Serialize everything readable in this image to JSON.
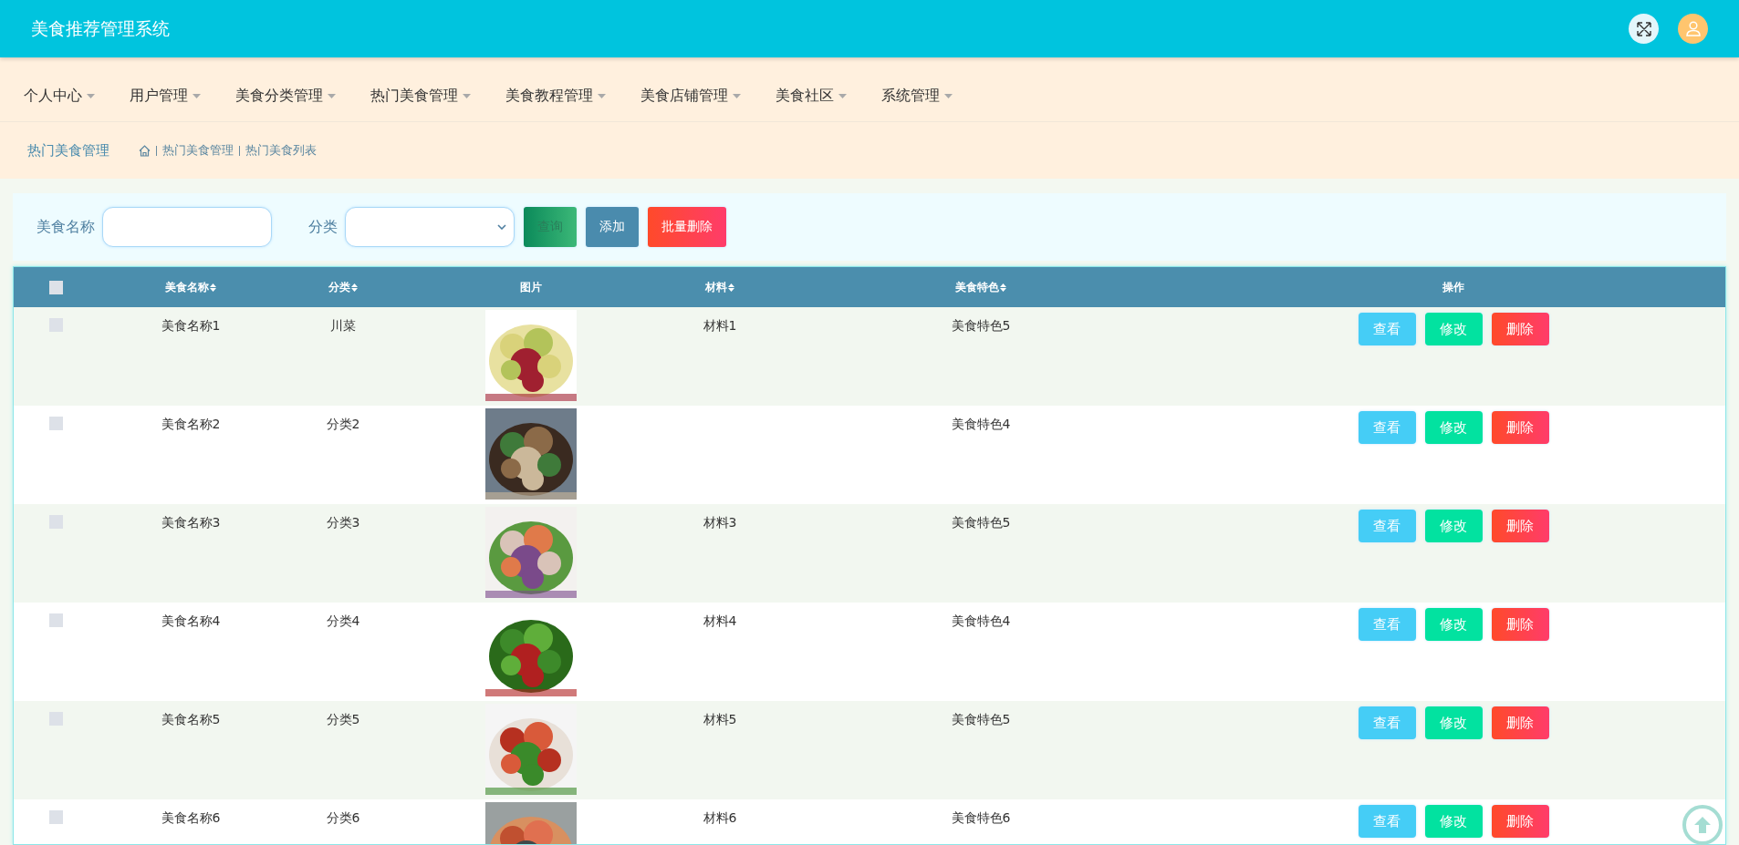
{
  "header": {
    "title": "美食推荐管理系统"
  },
  "nav": [
    {
      "label": "个人中心"
    },
    {
      "label": "用户管理"
    },
    {
      "label": "美食分类管理"
    },
    {
      "label": "热门美食管理"
    },
    {
      "label": "美食教程管理"
    },
    {
      "label": "美食店铺管理"
    },
    {
      "label": "美食社区"
    },
    {
      "label": "系统管理"
    }
  ],
  "breadcrumb": {
    "title": "热门美食管理",
    "items": [
      "热门美食管理",
      "热门美食列表"
    ]
  },
  "search": {
    "fields": [
      {
        "kind": "input",
        "label": "美食名称"
      },
      {
        "kind": "select",
        "label": "分类"
      }
    ],
    "buttons": [
      {
        "kind": "query",
        "label": "查询"
      },
      {
        "kind": "add",
        "label": "添加"
      },
      {
        "kind": "danger",
        "label": "批量删除"
      }
    ]
  },
  "table": {
    "all_checked": false,
    "columns": [
      {
        "label": "美食名称",
        "sortable": true
      },
      {
        "label": "分类",
        "sortable": true
      },
      {
        "label": "图片",
        "sortable": false
      },
      {
        "label": "材料",
        "sortable": true
      },
      {
        "label": "美食特色",
        "sortable": true
      },
      {
        "label": "操作",
        "sortable": false
      }
    ],
    "rows": [
      {
        "checked": false,
        "name": "美食名称1",
        "category": "川菜",
        "material": "材料1",
        "feature": "美食特色5",
        "actions": [
          {
            "kind": "view",
            "label": "查看"
          },
          {
            "kind": "edit",
            "label": "修改"
          },
          {
            "kind": "delete",
            "label": "删除"
          }
        ]
      },
      {
        "checked": false,
        "name": "美食名称2",
        "category": "分类2",
        "feature": "美食特色4",
        "actions": [
          {
            "kind": "view",
            "label": "查看"
          },
          {
            "kind": "edit",
            "label": "修改"
          },
          {
            "kind": "delete",
            "label": "删除"
          }
        ]
      },
      {
        "checked": false,
        "name": "美食名称3",
        "category": "分类3",
        "material": "材料3",
        "feature": "美食特色5",
        "actions": [
          {
            "kind": "view",
            "label": "查看"
          },
          {
            "kind": "edit",
            "label": "修改"
          },
          {
            "kind": "delete",
            "label": "删除"
          }
        ]
      },
      {
        "checked": false,
        "name": "美食名称4",
        "category": "分类4",
        "material": "材料4",
        "feature": "美食特色4",
        "actions": [
          {
            "kind": "view",
            "label": "查看"
          },
          {
            "kind": "edit",
            "label": "修改"
          },
          {
            "kind": "delete",
            "label": "删除"
          }
        ]
      },
      {
        "checked": false,
        "name": "美食名称5",
        "category": "分类5",
        "material": "材料5",
        "feature": "美食特色5",
        "actions": [
          {
            "kind": "view",
            "label": "查看"
          },
          {
            "kind": "edit",
            "label": "修改"
          },
          {
            "kind": "delete",
            "label": "删除"
          }
        ]
      },
      {
        "checked": false,
        "name": "美食名称6",
        "category": "分类6",
        "material": "材料6",
        "feature": "美食特色6",
        "actions": [
          {
            "kind": "view",
            "label": "查看"
          },
          {
            "kind": "edit",
            "label": "修改"
          },
          {
            "kind": "delete",
            "label": "删除"
          }
        ]
      }
    ]
  }
}
